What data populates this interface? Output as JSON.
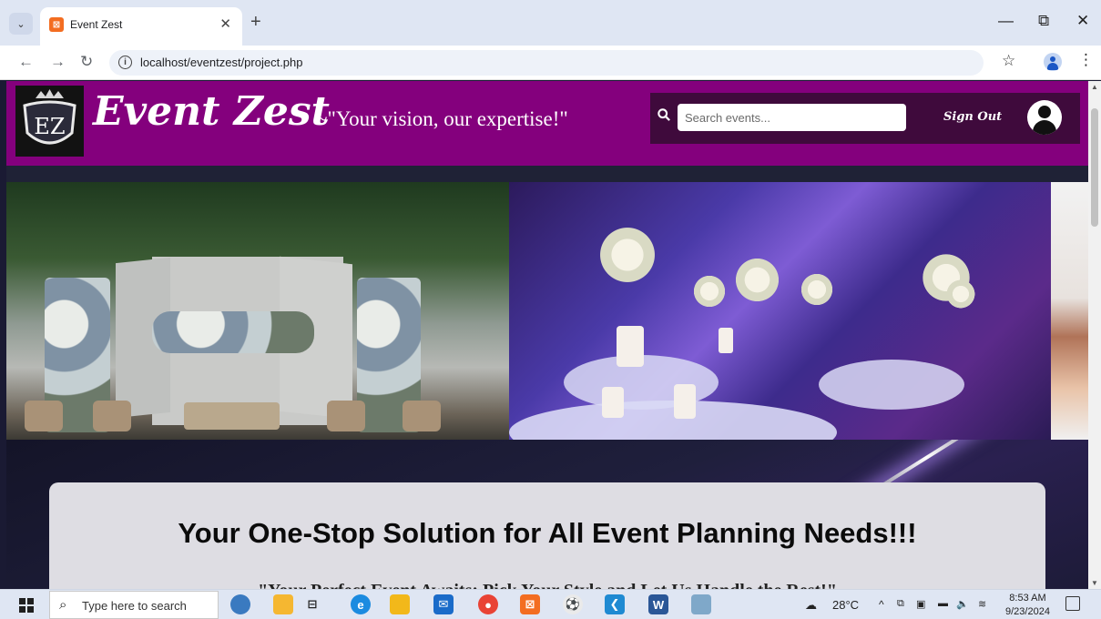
{
  "browser": {
    "tab_title": "Event Zest",
    "tab_favicon": "xampp-icon",
    "url": "localhost/eventzest/project.php"
  },
  "site": {
    "brand": "Event Zest",
    "tagline": "~\"Your vision, our expertise!\"",
    "logo_text": "EZ",
    "search_placeholder": "Search events...",
    "signout_label": "Sign Out",
    "hero_title": "Your One-Stop Solution for All Event Planning Needs!!!",
    "hero_subtitle": "\"Your Perfect Event Awaits: Pick Your Style and Let Us Handle the Rest!\""
  },
  "taskbar": {
    "search_placeholder": "Type here to search",
    "weather": "28°C",
    "time": "8:53 AM",
    "date": "9/23/2024"
  },
  "colors": {
    "header_bg": "#84007d",
    "search_panel_bg": "#3f0a3c",
    "card_bg": "#dedde3"
  }
}
